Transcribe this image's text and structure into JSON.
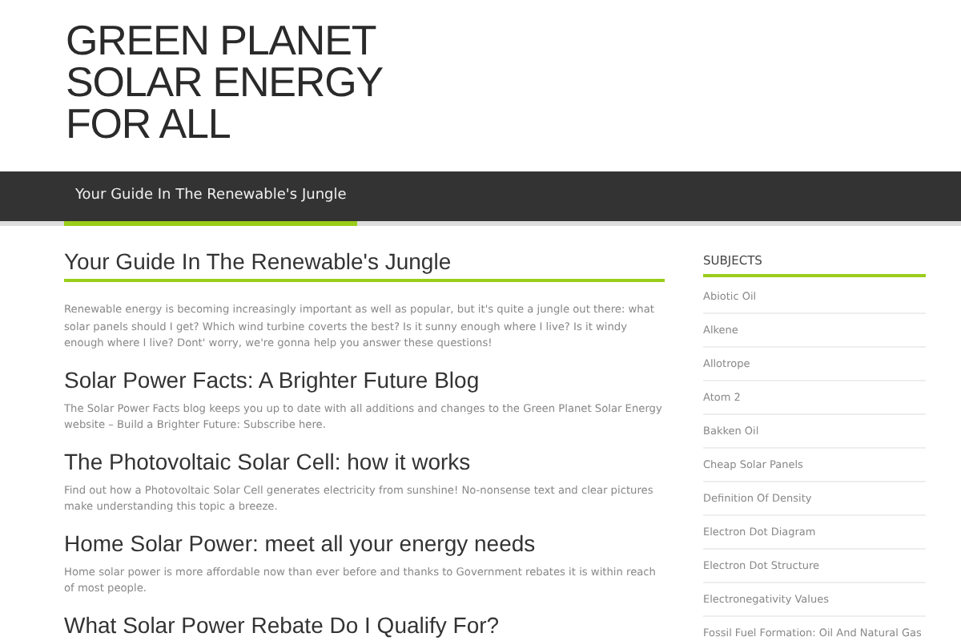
{
  "site_title": "GREEN PLANET SOLAR ENERGY FOR ALL",
  "nav": [
    {
      "label": "Your Guide In The Renewable's Jungle",
      "selected": true
    }
  ],
  "articles": [
    {
      "title": "Your Guide In The Renewable's Jungle",
      "kind": "lead",
      "text": "Renewable energy is becoming increasingly important as well as popular, but it's quite a jungle out there: what solar panels should I get? Which wind turbine coverts the best? Is it sunny enough where I live? Is it windy enough where I live? Dont' worry, we're gonna help you answer these questions!"
    },
    {
      "title": "Solar Power Facts: A Brighter Future Blog",
      "kind": "post",
      "text": "The Solar Power Facts blog keeps you up to date with all additions and changes to the Green Planet Solar Energy website – Build a Brighter Future: Subscribe here."
    },
    {
      "title": "The Photovoltaic Solar Cell: how it works",
      "kind": "post",
      "text": "Find out how a Photovoltaic Solar Cell generates electricity from sunshine! No-nonsense text and clear pictures make understanding this topic a breeze."
    },
    {
      "title": "Home Solar Power: meet all your energy needs",
      "kind": "post",
      "text": "Home solar power is more affordable now than ever before and thanks to Government rebates it is within reach of most people."
    },
    {
      "title": "What Solar Power Rebate Do I Qualify For?",
      "kind": "post"
    }
  ],
  "sidebar": {
    "title": "SUBJECTS",
    "items": [
      "Abiotic Oil",
      "Alkene",
      "Allotrope",
      "Atom 2",
      "Bakken Oil",
      "Cheap Solar Panels",
      "Definition Of Density",
      "Electron Dot Diagram",
      "Electron Dot Structure",
      "Electronegativity Values",
      "Fossil Fuel Formation: Oil And Natural Gas"
    ]
  }
}
